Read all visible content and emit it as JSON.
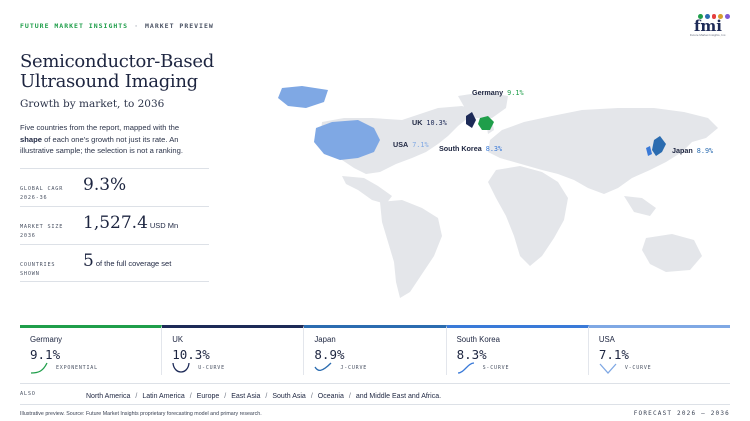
{
  "header": {
    "brand": "FUTURE MARKET INSIGHTS",
    "separator": "·",
    "kind": "MARKET PREVIEW",
    "logo_word": "fmi",
    "logo_tagline": "Future Market Insights, Inc.",
    "logo_dot_colors": [
      "#1f9e4a",
      "#2b6cb0",
      "#e53e3e",
      "#d69e2e",
      "#805ad5"
    ]
  },
  "title": "Semiconductor-Based Ultrasound Imaging",
  "subtitle": "Growth by market, to 2036",
  "description": {
    "part1": "Five countries from the report, mapped with the ",
    "bold": "shape",
    "part2": " of each one's growth not just its rate. An illustrative sample; the selection is not a ranking."
  },
  "stats": {
    "cagr": {
      "label_line1": "GLOBAL CAGR",
      "label_line2": "2026-36",
      "value": "9.3%"
    },
    "size": {
      "label_line1": "MARKET SIZE",
      "label_line2": "2036",
      "value": "1,527.4",
      "unit": "USD Mn"
    },
    "countries": {
      "label_line1": "COUNTRIES",
      "label_line2": "SHOWN",
      "value": "5",
      "note": "of the full coverage set"
    }
  },
  "colors": {
    "Germany": "#1f9e4a",
    "UK": "#1d2a57",
    "Japan": "#2b6cb0",
    "South Korea": "#3a7ad8",
    "USA": "#7fa8e4",
    "land": "#e4e6ea"
  },
  "chart_data": {
    "type": "choropleth-map",
    "series": [
      {
        "country": "Germany",
        "cagr": "9.1%",
        "value": 9.1,
        "curve": "EXPONENTIAL"
      },
      {
        "country": "UK",
        "cagr": "10.3%",
        "value": 10.3,
        "curve": "U-CURVE"
      },
      {
        "country": "Japan",
        "cagr": "8.9%",
        "value": 8.9,
        "curve": "J-CURVE"
      },
      {
        "country": "South Korea",
        "cagr": "8.3%",
        "value": 8.3,
        "curve": "S-CURVE"
      },
      {
        "country": "USA",
        "cagr": "7.1%",
        "value": 7.1,
        "curve": "V-CURVE"
      }
    ]
  },
  "map_labels": {
    "germany": {
      "name": "Germany",
      "pct": "9.1%"
    },
    "uk": {
      "name": "UK",
      "pct": "10.3%"
    },
    "usa": {
      "name": "USA",
      "pct": "7.1%"
    },
    "south_korea": {
      "name": "South Korea",
      "pct": "8.3%"
    },
    "japan": {
      "name": "Japan",
      "pct": "8.9%"
    }
  },
  "also": {
    "label": "ALSO",
    "regions": [
      "North America",
      "Latin America",
      "Europe",
      "East Asia",
      "South Asia",
      "Oceania",
      "and Middle East and Africa."
    ]
  },
  "footer": {
    "source": "Illustrative preview. Source: Future Market Insights proprietary forecasting model and primary research.",
    "forecast": "FORECAST 2026 – 2036"
  }
}
